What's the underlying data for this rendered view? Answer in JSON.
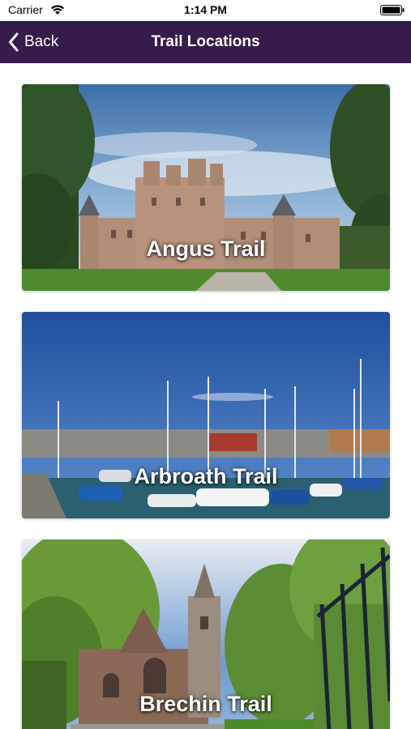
{
  "status_bar": {
    "carrier": "Carrier",
    "time": "1:14 PM"
  },
  "nav": {
    "back_label": "Back",
    "title": "Trail Locations"
  },
  "trails": [
    {
      "label": "Angus Trail",
      "image": "castle-photo"
    },
    {
      "label": "Arbroath Trail",
      "image": "harbour-photo"
    },
    {
      "label": "Brechin Trail",
      "image": "cathedral-photo"
    }
  ],
  "colors": {
    "nav_bar": "#351c4a",
    "text_on_nav": "#ffffff"
  }
}
